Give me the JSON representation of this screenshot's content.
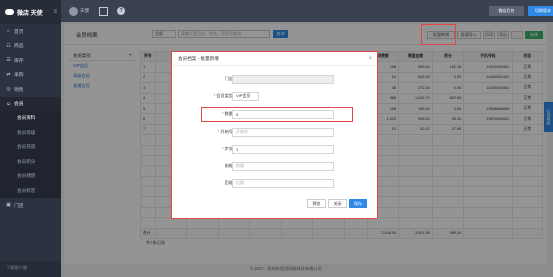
{
  "sidebar": {
    "logo": "微店 天使",
    "toggle": "≡",
    "items": [
      {
        "icon": "⌂",
        "label": "首页"
      },
      {
        "icon": "☷",
        "label": "商品"
      },
      {
        "icon": "☰",
        "label": "库存"
      },
      {
        "icon": "⇄",
        "label": "采购"
      },
      {
        "icon": "◎",
        "label": "销售"
      },
      {
        "icon": "☺",
        "label": "会员"
      }
    ],
    "sub_items": [
      "会员资料",
      "会员等级",
      "会员充值",
      "会员积分",
      "会员储值",
      "会员标签"
    ],
    "after_items": [
      {
        "icon": "▣",
        "label": "门店"
      }
    ],
    "footer": "下载客户端"
  },
  "topbar": {
    "user": "天使",
    "btn1": "微店后台",
    "btn2": "切换版本"
  },
  "content": {
    "title": "会员档案",
    "search_select": "全部",
    "search_placeholder": "请输入会员名、姓名、手机号查询",
    "search_btn": "查询",
    "actions": [
      "批量新增",
      "批量导入",
      "打印",
      "导出",
      "新增"
    ],
    "level_head": "会员类别",
    "level_plus": "+",
    "levels": [
      "VIP会员",
      "高级会员",
      "普通会员"
    ],
    "columns": [
      "序号",
      "",
      "",
      "",
      "",
      "",
      "",
      "",
      "消费额",
      "储值金额",
      "积分",
      "手机号码",
      "状态"
    ],
    "rows": [
      {
        "no": "1",
        "spend": "158",
        "balance": "889.40",
        "points": "152.18",
        "phone": "13400003451",
        "status": "正常"
      },
      {
        "no": "2",
        "spend": "54",
        "balance": "545.25",
        "points": "0.00",
        "phone": "13460002452",
        "status": "正常"
      },
      {
        "no": "3",
        "spend": "38",
        "balance": "372.30",
        "points": "0.00",
        "phone": "13460003451",
        "status": "正常"
      },
      {
        "no": "4",
        "spend": "988",
        "balance": "1,032.70",
        "points": "852.65",
        "phone": "",
        "status": "正常"
      },
      {
        "no": "5",
        "spend": "108",
        "balance": "108.00",
        "points": "0.00",
        "phone": "13666666666",
        "status": "正常"
      },
      {
        "no": "6",
        "spend": "1,033",
        "balance": "998.00",
        "points": "98.30",
        "phone": "13876529652",
        "status": "正常"
      },
      {
        "no": "7",
        "spend": "51",
        "balance": "52.97",
        "points": "37.95",
        "phone": "",
        "status": "正常"
      }
    ],
    "sum_label": "合计",
    "sum": {
      "spend": "2,145.00",
      "balance": "3,997.06",
      "points": "989.20"
    },
    "record_count": "共7条记录"
  },
  "side_tab": "在线客服",
  "footer": "© 2017 · 深圳市思迅网络科技有限公司",
  "modal": {
    "title": "会员档案 - 批量新增",
    "close": "×",
    "fields": [
      {
        "label": "门店",
        "value": "",
        "required": false,
        "placeholder": ""
      },
      {
        "label": "会员类型",
        "value": "VIP会员",
        "required": true,
        "placeholder": ""
      },
      {
        "label": "数量",
        "value": "0",
        "required": true,
        "placeholder": ""
      },
      {
        "label": "开始号",
        "value": "",
        "required": true,
        "placeholder": "开始号"
      },
      {
        "label": "步长",
        "value": "1",
        "required": true,
        "placeholder": ""
      },
      {
        "label": "前缀",
        "value": "",
        "required": false,
        "placeholder": "前缀"
      },
      {
        "label": "后缀",
        "value": "",
        "required": false,
        "placeholder": "后缀"
      }
    ],
    "btn_preview": "预览",
    "btn_close": "关闭",
    "btn_save": "保存"
  },
  "colors": {
    "accent": "#2e8ae6",
    "highlight": "#e24747",
    "success": "#3cb371",
    "sidebar": "#2b3240"
  }
}
